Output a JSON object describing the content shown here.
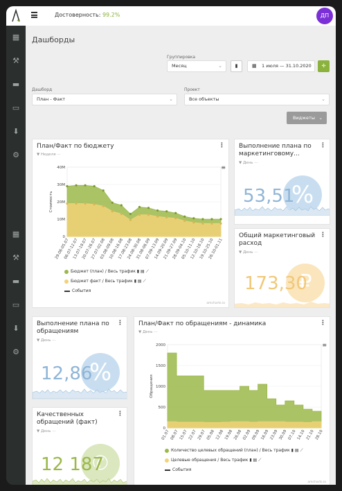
{
  "top": {
    "reliability_label": "Достоверность:",
    "reliability_value": "99.2%",
    "avatar": "ДП"
  },
  "page": {
    "title": "Дашборды"
  },
  "filters": {
    "grouping_label": "Группировка",
    "grouping_value": "Месяц",
    "date_range": "1 июля — 31.10.2020",
    "dashboard_label": "Дашборд",
    "dashboard_value": "План - Факт",
    "project_label": "Проект",
    "project_value": "Все объекты",
    "widgets_button": "Виджеты"
  },
  "cards": {
    "plan_fact_budget": {
      "title": "План/Факт по бюджету",
      "period": "Неделя",
      "legend": [
        "Бюджет (план) / Весь трафик",
        "Бюджет факт / Весь трафик",
        "События"
      ],
      "credit": "amcharts.io"
    },
    "marketing_plan": {
      "title": "Выполнение плана по маркетинговому...",
      "period": "День",
      "value": "53,51",
      "icon": "%"
    },
    "marketing_cost": {
      "title": "Общий маркетинговый расход",
      "period": "День",
      "value": "173,30",
      "icon": "₽"
    },
    "requests_plan": {
      "title": "Выполнение плана по обращениям",
      "period": "День",
      "value": "12,86",
      "icon": "%"
    },
    "quality_requests": {
      "title": "Качественных обращений (факт)",
      "period": "День",
      "value": "12 187"
    },
    "requests_dynamics": {
      "title": "План/Факт по обращениям - динамика",
      "period": "День",
      "legend": [
        "Количество целевых обращений (план) / Весь трафик",
        "Целевые обращения / Весь трафик",
        "События"
      ],
      "credit": "amcharts.io"
    }
  },
  "chart_data": [
    {
      "type": "area",
      "title": "План/Факт по бюджету",
      "ylabel": "Стоимость",
      "ylim": [
        0,
        40000000
      ],
      "yticks": [
        "0",
        "10M",
        "20M",
        "30M",
        "40M"
      ],
      "categories": [
        "29.06-05.07",
        "06.07-12.07",
        "13.07-19.07",
        "20.07-26.07",
        "27.07-02.08",
        "03.08-09.08",
        "10.08-16.08",
        "17.08-23.08",
        "24.08-30.08",
        "31.08-06.09",
        "07.09-13.09",
        "14.09-20.09",
        "21.09-27.09",
        "28.09-04.10",
        "05.10-11.10",
        "12.10-18.10",
        "19.10-25.10",
        "26.10-01.11"
      ],
      "series": [
        {
          "name": "Бюджет (план) / Весь трафик",
          "color": "#9bb84a",
          "values": [
            29,
            29.5,
            29.5,
            29,
            26.5,
            19.5,
            18,
            13,
            17,
            16.5,
            15,
            14.5,
            13.5,
            11.5,
            10.5,
            10,
            10,
            10
          ]
        },
        {
          "name": "Бюджет факт / Весь трафик",
          "color": "#f2d277",
          "values": [
            19,
            19,
            19,
            18.5,
            17.5,
            14.5,
            13,
            9.5,
            12.5,
            12.5,
            11.5,
            11,
            10.5,
            9,
            8,
            7.5,
            7.5,
            7.5
          ]
        }
      ]
    },
    {
      "type": "area",
      "title": "План/Факт по обращениям - динамика",
      "ylabel": "Обращения",
      "ylim": [
        0,
        2000
      ],
      "yticks": [
        "0",
        "500",
        "1000",
        "1500",
        "2000"
      ],
      "categories": [
        "01.07",
        "08.07",
        "15.07",
        "22.07",
        "29.07",
        "05.08",
        "12.08",
        "19.08",
        "26.08",
        "02.09",
        "09.09",
        "16.09",
        "23.09",
        "30.09",
        "07.10",
        "14.10",
        "21.10",
        "28.10"
      ],
      "series": [
        {
          "name": "Количество целевых обращений (план) / Весь трафик",
          "color": "#9bb84a",
          "values": [
            1800,
            1250,
            1250,
            1250,
            900,
            900,
            900,
            900,
            1000,
            900,
            1050,
            700,
            550,
            650,
            550,
            450,
            400,
            400
          ]
        },
        {
          "name": "Целевые обращения / Весь трафик",
          "color": "#f2d277",
          "values": [
            150,
            140,
            140,
            140,
            130,
            130,
            140,
            150,
            150,
            140,
            150,
            150,
            150,
            140,
            140,
            130,
            150,
            150
          ]
        }
      ]
    }
  ]
}
